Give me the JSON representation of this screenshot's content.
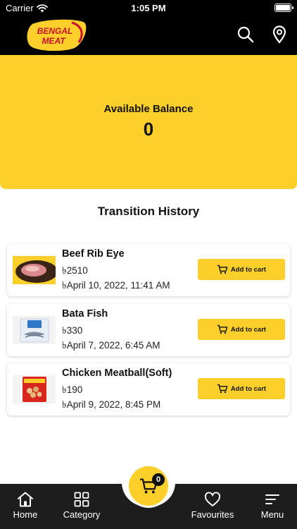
{
  "status_bar": {
    "carrier": "Carrier",
    "time": "1:05 PM",
    "icons": [
      "wifi-icon",
      "battery-icon"
    ]
  },
  "header": {
    "logo_text": [
      "BENGAL",
      "MEAT"
    ],
    "icons": [
      "search-icon",
      "location-pin-icon"
    ]
  },
  "balance": {
    "label": "Available Balance",
    "value": "0"
  },
  "history": {
    "title": "Transition History",
    "items": [
      {
        "name": "Beef Rib Eye",
        "price": "৳2510",
        "date": "৳April 10, 2022, 11:41 AM",
        "button_label": "Add to cart",
        "thumbnail": "beef-rib-eye-image"
      },
      {
        "name": "Bata Fish",
        "price": "৳330",
        "date": "৳April 7, 2022, 6:45 AM",
        "button_label": "Add to cart",
        "thumbnail": "bata-fish-image"
      },
      {
        "name": "Chicken Meatball(Soft)",
        "price": "৳190",
        "date": "৳April 9, 2022, 8:45 PM",
        "button_label": "Add to cart",
        "thumbnail": "chicken-meatball-image"
      }
    ]
  },
  "bottom_nav": {
    "items": [
      {
        "label": "Home",
        "icon": "home-icon"
      },
      {
        "label": "Category",
        "icon": "grid-icon"
      },
      {
        "label": "Favourites",
        "icon": "heart-icon"
      },
      {
        "label": "Menu",
        "icon": "menu-icon"
      }
    ],
    "cart_count": "0"
  },
  "colors": {
    "brand_yellow": "#fdcf2a",
    "header_black": "#000000",
    "nav_dark": "#1d1d1d"
  }
}
